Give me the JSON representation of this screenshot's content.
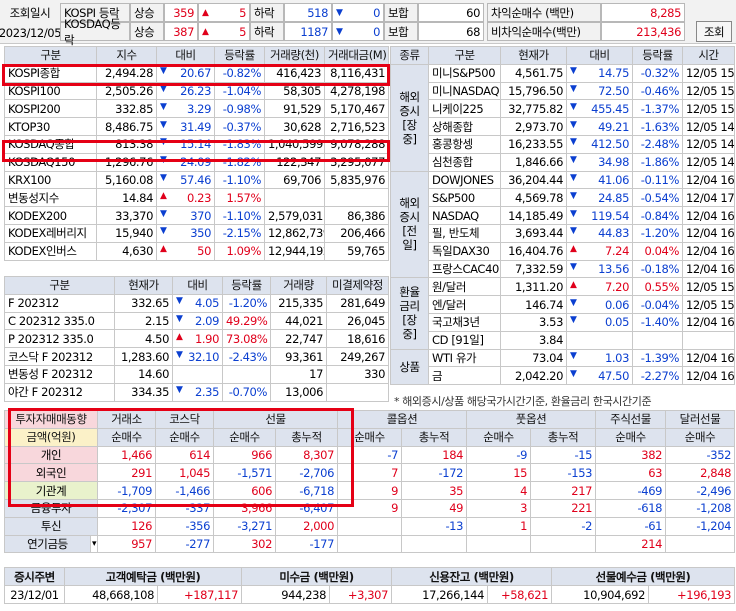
{
  "header": {
    "date_label": "조회일시",
    "date": "2023/12/05",
    "rows": [
      {
        "market": "KOSPI 등락",
        "up_label": "상승",
        "up": "359",
        "limit_up": "5",
        "down_label": "하락",
        "down": "518",
        "limit_down": "0",
        "flat_label": "보합",
        "flat": "60"
      },
      {
        "market": "KOSDAQ등락",
        "up_label": "상승",
        "up": "387",
        "limit_up": "5",
        "down_label": "하락",
        "down": "1187",
        "limit_down": "0",
        "flat_label": "보합",
        "flat": "68"
      }
    ],
    "net1_label": "차익순매수 (백만)",
    "net1": "8,285",
    "net2_label": "비차익순매수(백만)",
    "net2": "213,436",
    "query_button": "조회"
  },
  "index_table": {
    "headers": [
      "구분",
      "지수",
      "대비",
      "등락률",
      "거래량(천)",
      "거래대금(M)"
    ],
    "rows": [
      [
        "KOSPI종합",
        "2,494.28",
        "▼",
        "20.67",
        "-0.82%",
        "416,423",
        "8,116,431"
      ],
      [
        "KOSPI100",
        "2,505.26",
        "▼",
        "26.23",
        "-1.04%",
        "58,305",
        "4,278,198"
      ],
      [
        "KOSPI200",
        "332.85",
        "▼",
        "3.29",
        "-0.98%",
        "91,529",
        "5,170,467"
      ],
      [
        "KTOP30",
        "8,486.75",
        "▼",
        "31.49",
        "-0.37%",
        "30,628",
        "2,716,523"
      ],
      [
        "KOSDAQ종합",
        "813.38",
        "▼",
        "15.14",
        "-1.83%",
        "1,040,599",
        "9,078,288"
      ],
      [
        "KOSDAQ150",
        "1,296.76",
        "▼",
        "24.09",
        "-1.82%",
        "122,347",
        "3,295,077"
      ],
      [
        "KRX100",
        "5,160.08",
        "▼",
        "57.46",
        "-1.10%",
        "69,706",
        "5,835,976"
      ],
      [
        "변동성지수",
        "14.84",
        "▲",
        "0.23",
        "1.57%",
        "",
        ""
      ],
      [
        "KODEX200",
        "33,370",
        "▼",
        "370",
        "-1.10%",
        "2,579,031",
        "86,386"
      ],
      [
        "KODEX레버리지",
        "15,940",
        "▼",
        "350",
        "-2.15%",
        "12,862,739",
        "206,466"
      ],
      [
        "KODEX인버스",
        "4,630",
        "▲",
        "50",
        "1.09%",
        "12,944,192",
        "59,765"
      ]
    ]
  },
  "futures_table": {
    "headers": [
      "구분",
      "현재가",
      "대비",
      "등락률",
      "거래량",
      "미결제약정"
    ],
    "rows": [
      [
        "F 202312",
        "332.65",
        "▼",
        "4.05",
        "-1.20%",
        "215,335",
        "281,649"
      ],
      [
        "C 202312 335.0",
        "2.15",
        "▼",
        "2.09",
        "49.29%",
        "44,021",
        "26,045"
      ],
      [
        "P 202312 335.0",
        "4.50",
        "▲",
        "1.90",
        "73.08%",
        "22,747",
        "18,616"
      ],
      [
        "코스닥 F 202312",
        "1,283.60",
        "▼",
        "32.10",
        "-2.43%",
        "93,361",
        "249,267"
      ],
      [
        "변동성 F 202312",
        "14.60",
        "",
        "",
        "",
        "17",
        "330"
      ],
      [
        "야간 F 202312",
        "334.35",
        "▼",
        "2.35",
        "-0.70%",
        "13,006",
        ""
      ]
    ]
  },
  "world_table": {
    "headers": [
      "종류",
      "구분",
      "현재가",
      "대비",
      "등락률",
      "시간"
    ],
    "groups": [
      {
        "label": "해외증시[장중]",
        "rows": [
          [
            "미니S&P500",
            "4,561.75",
            "▼",
            "14.75",
            "-0.32%",
            "12/05",
            "15:59"
          ],
          [
            "미니NASDAQ",
            "15,796.50",
            "▼",
            "72.50",
            "-0.46%",
            "12/05",
            "15:59"
          ],
          [
            "니케이225",
            "32,775.82",
            "▼",
            "455.45",
            "-1.37%",
            "12/05",
            "15:00"
          ],
          [
            "상해종합",
            "2,973.70",
            "▼",
            "49.21",
            "-1.63%",
            "12/05",
            "14:54"
          ],
          [
            "홍콩항셍",
            "16,233.55",
            "▼",
            "412.50",
            "-2.48%",
            "12/05",
            "14:54"
          ],
          [
            "심천종합",
            "1,846.66",
            "▼",
            "34.98",
            "-1.86%",
            "12/05",
            "14:54"
          ]
        ]
      },
      {
        "label": "해외증시[전일]",
        "rows": [
          [
            "DOWJONES",
            "36,204.44",
            "▼",
            "41.06",
            "-0.11%",
            "12/04",
            "16:10"
          ],
          [
            "S&P500",
            "4,569.78",
            "▼",
            "24.85",
            "-0.54%",
            "12/04",
            "17:03"
          ],
          [
            "NASDAQ",
            "14,185.49",
            "▼",
            "119.54",
            "-0.84%",
            "12/04",
            "16:15"
          ],
          [
            "필, 반도체",
            "3,693.44",
            "▼",
            "44.83",
            "-1.20%",
            "12/04",
            "16:15"
          ],
          [
            "독일DAX30",
            "16,404.76",
            "▲",
            "7.24",
            "0.04%",
            "12/04",
            "16:00"
          ],
          [
            "프랑스CAC40",
            "7,332.59",
            "▼",
            "13.56",
            "-0.18%",
            "12/04",
            "16:00"
          ]
        ]
      },
      {
        "label": "환율금리[장중]",
        "rows": [
          [
            "원/달러",
            "1,311.20",
            "▲",
            "7.20",
            "0.55%",
            "12/05",
            "15:30"
          ],
          [
            "엔/달러",
            "146.74",
            "▼",
            "0.06",
            "-0.04%",
            "12/05",
            "15:59"
          ],
          [
            "국고채3년",
            "3.53",
            "▼",
            "0.05",
            "-1.40%",
            "12/04",
            "16:00"
          ],
          [
            "CD [91일]",
            "3.84",
            "",
            "",
            "",
            "",
            ""
          ]
        ]
      },
      {
        "label": "상품",
        "rows": [
          [
            "WTI 유가",
            "73.04",
            "▼",
            "1.03",
            "-1.39%",
            "12/04",
            "16:00"
          ],
          [
            "금",
            "2,042.20",
            "▼",
            "47.50",
            "-2.27%",
            "12/04",
            "16:00"
          ]
        ]
      }
    ],
    "note": "* 해외증시/상품 해당국가시간기준, 환율금리 한국시간기준"
  },
  "investor_table": {
    "title": "투자자매매동향",
    "unit": "금액(억원)",
    "group_headers": [
      "거래소",
      "코스닥",
      "선물",
      "콜옵션",
      "풋옵션",
      "주식선물",
      "달러선물"
    ],
    "sub_headers": [
      "순매수",
      "순매수",
      "순매수",
      "총누적",
      "순매수",
      "총누적",
      "순매수",
      "총누적",
      "순매수",
      "순매수"
    ],
    "rows": [
      [
        "개인",
        "1,466",
        "614",
        "966",
        "8,307",
        "-7",
        "184",
        "-9",
        "-15",
        "382",
        "-352"
      ],
      [
        "외국인",
        "291",
        "1,045",
        "-1,571",
        "-2,706",
        "7",
        "-172",
        "15",
        "-153",
        "63",
        "2,848"
      ],
      [
        "기관계",
        "-1,709",
        "-1,466",
        "606",
        "-6,718",
        "9",
        "35",
        "4",
        "217",
        "-469",
        "-2,496"
      ],
      [
        "금융투자",
        "-2,307",
        "-337",
        "3,966",
        "-6,407",
        "9",
        "49",
        "3",
        "221",
        "-618",
        "-1,208"
      ],
      [
        "투신",
        "126",
        "-356",
        "-3,271",
        "2,000",
        "",
        "-13",
        "1",
        "-2",
        "-61",
        "-1,204"
      ],
      [
        "연기금등",
        "957",
        "-277",
        "302",
        "-177",
        "",
        "",
        "",
        "",
        "214",
        ""
      ]
    ]
  },
  "bottom_table": {
    "headers": [
      "증시주변",
      "고객예탁금 (백만원)",
      "미수금 (백만원)",
      "신용잔고 (백만원)",
      "선물예수금 (백만원)"
    ],
    "row": [
      "23/12/01",
      "48,668,108",
      "+187,117",
      "944,238",
      "+3,307",
      "17,266,144",
      "+58,621",
      "10,904,692",
      "+196,193"
    ]
  },
  "colors": {
    "up": "#e0001b",
    "down": "#0b3fd0",
    "highlight": "#e50015",
    "header_bg": "#dde3ee"
  }
}
